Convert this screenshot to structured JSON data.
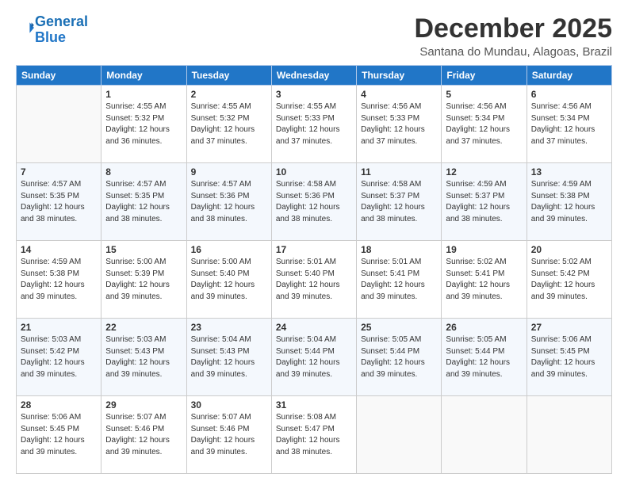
{
  "header": {
    "logo_line1": "General",
    "logo_line2": "Blue",
    "month": "December 2025",
    "location": "Santana do Mundau, Alagoas, Brazil"
  },
  "days": [
    "Sunday",
    "Monday",
    "Tuesday",
    "Wednesday",
    "Thursday",
    "Friday",
    "Saturday"
  ],
  "weeks": [
    [
      {
        "day": "",
        "content": ""
      },
      {
        "day": "1",
        "content": "Sunrise: 4:55 AM\nSunset: 5:32 PM\nDaylight: 12 hours\nand 36 minutes."
      },
      {
        "day": "2",
        "content": "Sunrise: 4:55 AM\nSunset: 5:32 PM\nDaylight: 12 hours\nand 37 minutes."
      },
      {
        "day": "3",
        "content": "Sunrise: 4:55 AM\nSunset: 5:33 PM\nDaylight: 12 hours\nand 37 minutes."
      },
      {
        "day": "4",
        "content": "Sunrise: 4:56 AM\nSunset: 5:33 PM\nDaylight: 12 hours\nand 37 minutes."
      },
      {
        "day": "5",
        "content": "Sunrise: 4:56 AM\nSunset: 5:34 PM\nDaylight: 12 hours\nand 37 minutes."
      },
      {
        "day": "6",
        "content": "Sunrise: 4:56 AM\nSunset: 5:34 PM\nDaylight: 12 hours\nand 37 minutes."
      }
    ],
    [
      {
        "day": "7",
        "content": "Sunrise: 4:57 AM\nSunset: 5:35 PM\nDaylight: 12 hours\nand 38 minutes."
      },
      {
        "day": "8",
        "content": "Sunrise: 4:57 AM\nSunset: 5:35 PM\nDaylight: 12 hours\nand 38 minutes."
      },
      {
        "day": "9",
        "content": "Sunrise: 4:57 AM\nSunset: 5:36 PM\nDaylight: 12 hours\nand 38 minutes."
      },
      {
        "day": "10",
        "content": "Sunrise: 4:58 AM\nSunset: 5:36 PM\nDaylight: 12 hours\nand 38 minutes."
      },
      {
        "day": "11",
        "content": "Sunrise: 4:58 AM\nSunset: 5:37 PM\nDaylight: 12 hours\nand 38 minutes."
      },
      {
        "day": "12",
        "content": "Sunrise: 4:59 AM\nSunset: 5:37 PM\nDaylight: 12 hours\nand 38 minutes."
      },
      {
        "day": "13",
        "content": "Sunrise: 4:59 AM\nSunset: 5:38 PM\nDaylight: 12 hours\nand 39 minutes."
      }
    ],
    [
      {
        "day": "14",
        "content": "Sunrise: 4:59 AM\nSunset: 5:38 PM\nDaylight: 12 hours\nand 39 minutes."
      },
      {
        "day": "15",
        "content": "Sunrise: 5:00 AM\nSunset: 5:39 PM\nDaylight: 12 hours\nand 39 minutes."
      },
      {
        "day": "16",
        "content": "Sunrise: 5:00 AM\nSunset: 5:40 PM\nDaylight: 12 hours\nand 39 minutes."
      },
      {
        "day": "17",
        "content": "Sunrise: 5:01 AM\nSunset: 5:40 PM\nDaylight: 12 hours\nand 39 minutes."
      },
      {
        "day": "18",
        "content": "Sunrise: 5:01 AM\nSunset: 5:41 PM\nDaylight: 12 hours\nand 39 minutes."
      },
      {
        "day": "19",
        "content": "Sunrise: 5:02 AM\nSunset: 5:41 PM\nDaylight: 12 hours\nand 39 minutes."
      },
      {
        "day": "20",
        "content": "Sunrise: 5:02 AM\nSunset: 5:42 PM\nDaylight: 12 hours\nand 39 minutes."
      }
    ],
    [
      {
        "day": "21",
        "content": "Sunrise: 5:03 AM\nSunset: 5:42 PM\nDaylight: 12 hours\nand 39 minutes."
      },
      {
        "day": "22",
        "content": "Sunrise: 5:03 AM\nSunset: 5:43 PM\nDaylight: 12 hours\nand 39 minutes."
      },
      {
        "day": "23",
        "content": "Sunrise: 5:04 AM\nSunset: 5:43 PM\nDaylight: 12 hours\nand 39 minutes."
      },
      {
        "day": "24",
        "content": "Sunrise: 5:04 AM\nSunset: 5:44 PM\nDaylight: 12 hours\nand 39 minutes."
      },
      {
        "day": "25",
        "content": "Sunrise: 5:05 AM\nSunset: 5:44 PM\nDaylight: 12 hours\nand 39 minutes."
      },
      {
        "day": "26",
        "content": "Sunrise: 5:05 AM\nSunset: 5:44 PM\nDaylight: 12 hours\nand 39 minutes."
      },
      {
        "day": "27",
        "content": "Sunrise: 5:06 AM\nSunset: 5:45 PM\nDaylight: 12 hours\nand 39 minutes."
      }
    ],
    [
      {
        "day": "28",
        "content": "Sunrise: 5:06 AM\nSunset: 5:45 PM\nDaylight: 12 hours\nand 39 minutes."
      },
      {
        "day": "29",
        "content": "Sunrise: 5:07 AM\nSunset: 5:46 PM\nDaylight: 12 hours\nand 39 minutes."
      },
      {
        "day": "30",
        "content": "Sunrise: 5:07 AM\nSunset: 5:46 PM\nDaylight: 12 hours\nand 39 minutes."
      },
      {
        "day": "31",
        "content": "Sunrise: 5:08 AM\nSunset: 5:47 PM\nDaylight: 12 hours\nand 38 minutes."
      },
      {
        "day": "",
        "content": ""
      },
      {
        "day": "",
        "content": ""
      },
      {
        "day": "",
        "content": ""
      }
    ]
  ]
}
